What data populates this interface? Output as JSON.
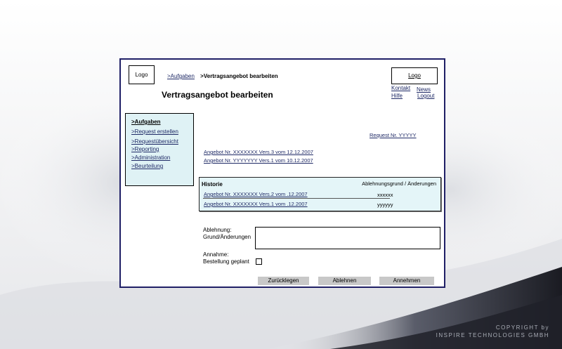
{
  "logo_left": "Logo",
  "logo_right": "Logo",
  "breadcrumb": {
    "link": ">Aufgaben",
    "current": ">Vertragsangebot bearbeiten"
  },
  "page_title": "Vertragsangebot bearbeiten",
  "top_links": {
    "kontakt": "Kontakt",
    "news": "News",
    "hilfe": "Hilfe",
    "logout": "Logout"
  },
  "nav": {
    "items": [
      ">Aufgaben",
      ">Request erstellen",
      ">Requestübersicht",
      ">Reporting",
      ">Administration",
      ">Beurteilung"
    ]
  },
  "request_nr": "Request Nr. YYYYY",
  "offers": [
    "Angebot Nr. XXXXXXX Vers.3 vom  12.12.2007",
    "Angebot Nr. YYYYYYY Vers.1 vom  10.12.2007"
  ],
  "history": {
    "title": "Historie",
    "column_header": "Ablehnungsgrund / Änderungen",
    "rows": [
      {
        "link": "Angebot Nr. XXXXXXX Vers.2 vom  .12.2007",
        "value": "xxxxxx"
      },
      {
        "link": "Angebot Nr. XXXXXXX Vers.1 vom  .12.2007",
        "value": "yyyyyy"
      }
    ]
  },
  "rejection_label_1": "Ablehnung:",
  "rejection_label_2": "Grund/Änderungen",
  "acceptance_label_1": "Annahme:",
  "acceptance_label_2": "Bestellung geplant",
  "buttons": {
    "return": "Zurücklegen",
    "reject": "Ablehnen",
    "accept": "Annehmen"
  },
  "copyright": {
    "line1": "COPYRIGHT by",
    "line2": "INSPIRE TECHNOLOGIES GMBH"
  }
}
